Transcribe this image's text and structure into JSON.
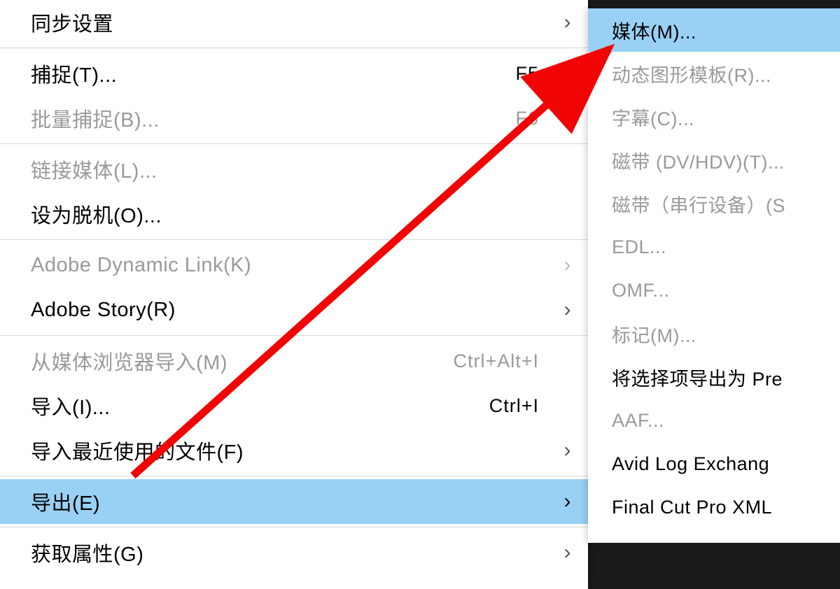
{
  "colors": {
    "highlight": "#99d1f5",
    "arrow": "#f10404",
    "disabled": "#9a9a9a"
  },
  "main_menu": {
    "items": [
      {
        "id": "sync-settings",
        "label": "同步设置",
        "shortcut": "",
        "has_submenu": true,
        "disabled": false,
        "group": 0
      },
      {
        "id": "capture",
        "label": "捕捉(T)...",
        "shortcut": "F5",
        "has_submenu": false,
        "disabled": false,
        "group": 1
      },
      {
        "id": "batch-capture",
        "label": "批量捕捉(B)...",
        "shortcut": "F6",
        "has_submenu": false,
        "disabled": true,
        "group": 1
      },
      {
        "id": "link-media",
        "label": "链接媒体(L)...",
        "shortcut": "",
        "has_submenu": false,
        "disabled": true,
        "group": 2
      },
      {
        "id": "set-offline",
        "label": "设为脱机(O)...",
        "shortcut": "",
        "has_submenu": false,
        "disabled": false,
        "group": 2
      },
      {
        "id": "dynamic-link",
        "label": "Adobe Dynamic Link(K)",
        "shortcut": "",
        "has_submenu": true,
        "disabled": true,
        "group": 3
      },
      {
        "id": "adobe-story",
        "label": "Adobe Story(R)",
        "shortcut": "",
        "has_submenu": true,
        "disabled": false,
        "group": 3
      },
      {
        "id": "import-from-browser",
        "label": "从媒体浏览器导入(M)",
        "shortcut": "Ctrl+Alt+I",
        "has_submenu": false,
        "disabled": true,
        "group": 4
      },
      {
        "id": "import",
        "label": "导入(I)...",
        "shortcut": "Ctrl+I",
        "has_submenu": false,
        "disabled": false,
        "group": 4
      },
      {
        "id": "import-recent",
        "label": "导入最近使用的文件(F)",
        "shortcut": "",
        "has_submenu": true,
        "disabled": false,
        "group": 4
      },
      {
        "id": "export",
        "label": "导出(E)",
        "shortcut": "",
        "has_submenu": true,
        "disabled": false,
        "highlighted": true,
        "group": 5
      },
      {
        "id": "get-properties",
        "label": "获取属性(G)",
        "shortcut": "",
        "has_submenu": true,
        "disabled": false,
        "group": 6
      }
    ]
  },
  "sub_menu": {
    "items": [
      {
        "id": "media",
        "label": "媒体(M)...",
        "disabled": false,
        "highlighted": true
      },
      {
        "id": "motion-graphics",
        "label": "动态图形模板(R)...",
        "disabled": true
      },
      {
        "id": "captions",
        "label": "字幕(C)...",
        "disabled": true
      },
      {
        "id": "tape-dv",
        "label": "磁带 (DV/HDV)(T)...",
        "disabled": true
      },
      {
        "id": "tape-serial",
        "label": "磁带（串行设备）(S",
        "disabled": true
      },
      {
        "id": "edl",
        "label": "EDL...",
        "disabled": true
      },
      {
        "id": "omf",
        "label": "OMF...",
        "disabled": true
      },
      {
        "id": "markers",
        "label": "标记(M)...",
        "disabled": true
      },
      {
        "id": "export-selection",
        "label": "将选择项导出为 Pre",
        "disabled": false
      },
      {
        "id": "aaf",
        "label": "AAF...",
        "disabled": true
      },
      {
        "id": "avid-log",
        "label": "Avid Log Exchang",
        "disabled": false
      },
      {
        "id": "final-cut",
        "label": "Final Cut Pro XML",
        "disabled": false
      }
    ]
  }
}
